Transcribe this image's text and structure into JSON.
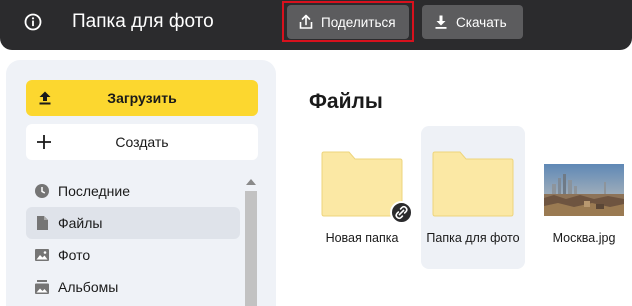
{
  "header": {
    "folder_title": "Папка для фото",
    "share_label": "Поделиться",
    "download_label": "Скачать"
  },
  "sidebar": {
    "upload_label": "Загрузить",
    "create_label": "Создать",
    "nav": [
      {
        "label": "Последние",
        "icon": "clock-icon"
      },
      {
        "label": "Файлы",
        "icon": "file-icon",
        "active": true
      },
      {
        "label": "Фото",
        "icon": "image-icon"
      },
      {
        "label": "Альбомы",
        "icon": "album-icon"
      }
    ]
  },
  "main": {
    "title": "Файлы",
    "files": [
      {
        "name": "Новая папка",
        "type": "folder",
        "shared": true
      },
      {
        "name": "Папка для фото",
        "type": "folder",
        "selected": true
      },
      {
        "name": "Москва.jpg",
        "type": "image"
      }
    ]
  },
  "colors": {
    "topbar": "#2b2b2d",
    "accent_yellow": "#fcd72f",
    "highlight_red": "#d8111d",
    "folder": "#fbe8a4"
  }
}
